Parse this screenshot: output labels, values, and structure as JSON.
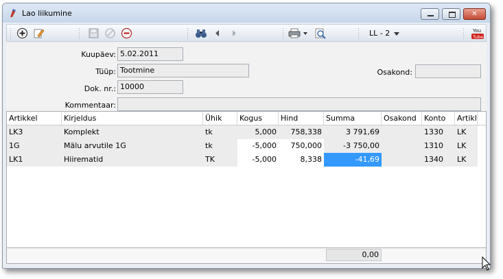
{
  "window": {
    "title": "Lao liikumine"
  },
  "toolbar": {
    "ll_label": "LL - 2"
  },
  "form": {
    "kuupaev_label": "Kuupäev:",
    "kuupaev_value": "5.02.2011",
    "tuup_label": "Tüüp:",
    "tuup_value": "Tootmine",
    "dok_label": "Dok. nr.:",
    "dok_value": "10000",
    "kommentaar_label": "Kommentaar:",
    "kommentaar_value": "",
    "osakond_label": "Osakond:",
    "osakond_value": ""
  },
  "grid": {
    "columns": [
      "Artikkel",
      "Kirjeldus",
      "Ühik",
      "Kogus",
      "Hind",
      "Summa",
      "Osakond",
      "Konto",
      "Artikl"
    ],
    "rows": [
      [
        "LK3",
        "Komplekt",
        "tk",
        "5,000",
        "758,338",
        "3 791,69",
        "",
        "1330",
        "LK"
      ],
      [
        "1G",
        "Mälu arvutile 1G",
        "tk",
        "-5,000",
        "750,000",
        "-3 750,00",
        "",
        "1310",
        "LK"
      ],
      [
        "LK1",
        "Hiirematid",
        "TK",
        "-5,000",
        "8,338",
        "-41,69",
        "",
        "1340",
        "LK"
      ]
    ],
    "total": "0,00"
  },
  "colors": {
    "selection": "#3399ff"
  },
  "icons": [
    "add-icon",
    "edit-icon",
    "save-icon",
    "cancel-icon",
    "delete-icon",
    "binoculars-icon",
    "prev-icon",
    "next-icon",
    "print-icon",
    "preview-icon",
    "youtube-icon"
  ]
}
